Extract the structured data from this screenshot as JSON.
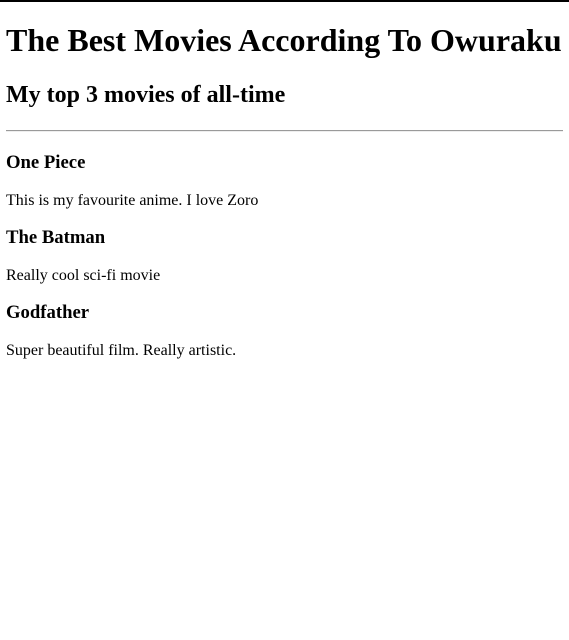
{
  "page": {
    "title": "The Best Movies According To Owuraku",
    "subtitle": "My top 3 movies of all-time"
  },
  "movies": [
    {
      "title": "One Piece",
      "description": "This is my favourite anime. I love Zoro"
    },
    {
      "title": "The Batman",
      "description": "Really cool sci-fi movie"
    },
    {
      "title": "Godfather",
      "description": "Super beautiful film. Really artistic."
    }
  ]
}
